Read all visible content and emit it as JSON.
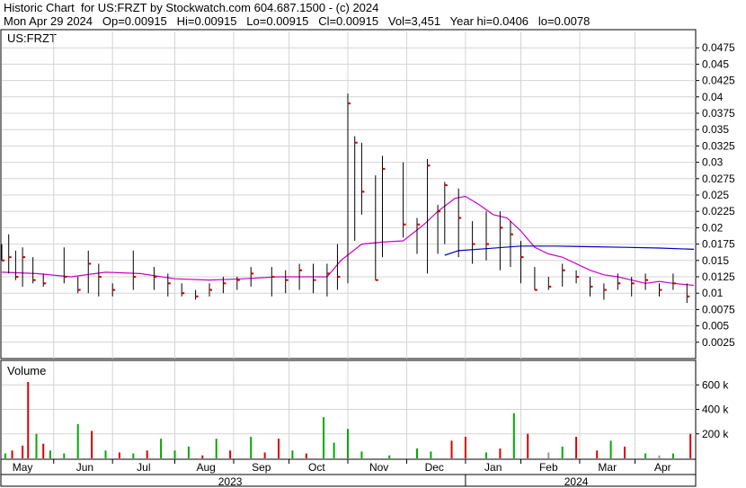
{
  "header": {
    "line1": "Historic Chart  for US:FRZT by Stockwatch.com 604.687.1500 - (c) 2024",
    "line2": "Mon Apr 29 2024   Op=0.00915   Hi=0.00915   Lo=0.00915   Cl=0.00915   Vol=3,451   Year hi=0.0406   lo=0.0078"
  },
  "chart_data": {
    "type": "ohlc-bar-with-volume",
    "symbol_label": "US:FRZT",
    "volume_label": "Volume",
    "price_axis": {
      "ylim": [
        0,
        0.05
      ],
      "ticks": [
        "0.0475",
        "0.045",
        "0.0425",
        "0.04",
        "0.0375",
        "0.035",
        "0.0325",
        "0.03",
        "0.0275",
        "0.025",
        "0.0225",
        "0.02",
        "0.0175",
        "0.015",
        "0.0125",
        "0.01",
        "0.0075",
        "0.005",
        "0.0025"
      ],
      "tick_values": [
        0.0475,
        0.045,
        0.0425,
        0.04,
        0.0375,
        0.035,
        0.0325,
        0.03,
        0.0275,
        0.025,
        0.0225,
        0.02,
        0.0175,
        0.015,
        0.0125,
        0.01,
        0.0075,
        0.005,
        0.0025
      ]
    },
    "volume_axis": {
      "ylim": [
        0,
        800000
      ],
      "ticks": [
        "600 k",
        "400 k",
        "200 k"
      ],
      "tick_values": [
        600000,
        400000,
        200000
      ]
    },
    "x_axis": {
      "months": [
        "May",
        "Jun",
        "Jul",
        "Aug",
        "Sep",
        "Oct",
        "Nov",
        "Dec",
        "Jan",
        "Feb",
        "Mar",
        "Apr"
      ],
      "years": [
        "2023",
        "2024"
      ]
    },
    "colors": {
      "price_bar": "#000000",
      "close_tick": "#cc0000",
      "ma_short": "#cc00cc",
      "ma_long": "#0000cc",
      "vol_up": "#00aa00",
      "vol_down": "#dd0000",
      "vol_neutral": "#999999",
      "grid": "#d4d4d4"
    },
    "series": [
      {
        "kind": "moving-average",
        "color": "#cc00cc",
        "points": [
          [
            0,
            0.0132
          ],
          [
            0.05,
            0.013
          ],
          [
            0.1,
            0.0125
          ],
          [
            0.15,
            0.0132
          ],
          [
            0.2,
            0.013
          ],
          [
            0.25,
            0.0122
          ],
          [
            0.3,
            0.012
          ],
          [
            0.35,
            0.0122
          ],
          [
            0.4,
            0.0125
          ],
          [
            0.45,
            0.0125
          ],
          [
            0.47,
            0.0125
          ],
          [
            0.49,
            0.015
          ],
          [
            0.52,
            0.0175
          ],
          [
            0.55,
            0.0178
          ],
          [
            0.58,
            0.018
          ],
          [
            0.61,
            0.0205
          ],
          [
            0.63,
            0.0225
          ],
          [
            0.655,
            0.0245
          ],
          [
            0.67,
            0.0248
          ],
          [
            0.69,
            0.0235
          ],
          [
            0.71,
            0.022
          ],
          [
            0.73,
            0.0215
          ],
          [
            0.75,
            0.0195
          ],
          [
            0.77,
            0.017
          ],
          [
            0.79,
            0.016
          ],
          [
            0.81,
            0.0155
          ],
          [
            0.83,
            0.0145
          ],
          [
            0.85,
            0.0135
          ],
          [
            0.87,
            0.0128
          ],
          [
            0.89,
            0.0125
          ],
          [
            0.91,
            0.012
          ],
          [
            0.93,
            0.0115
          ],
          [
            0.95,
            0.0118
          ],
          [
            0.97,
            0.0115
          ],
          [
            1.0,
            0.0112
          ]
        ]
      },
      {
        "kind": "moving-average",
        "color": "#0000cc",
        "points": [
          [
            0.64,
            0.0158
          ],
          [
            0.66,
            0.0165
          ],
          [
            0.7,
            0.0168
          ],
          [
            0.75,
            0.0172
          ],
          [
            0.8,
            0.0172
          ],
          [
            0.85,
            0.0171
          ],
          [
            0.9,
            0.017
          ],
          [
            0.95,
            0.0169
          ],
          [
            1.0,
            0.0167
          ]
        ]
      }
    ],
    "ohlc": [
      [
        0.0,
        0.0175,
        0.015,
        0.015
      ],
      [
        0.01,
        0.019,
        0.013,
        0.0155
      ],
      [
        0.02,
        0.0165,
        0.012,
        0.0125
      ],
      [
        0.03,
        0.017,
        0.011,
        0.0155
      ],
      [
        0.045,
        0.0155,
        0.0115,
        0.012
      ],
      [
        0.06,
        0.013,
        0.011,
        0.0115
      ],
      [
        0.09,
        0.017,
        0.0115,
        0.0125
      ],
      [
        0.11,
        0.0125,
        0.01,
        0.0105
      ],
      [
        0.125,
        0.0165,
        0.01,
        0.0145
      ],
      [
        0.14,
        0.0145,
        0.0095,
        0.0125
      ],
      [
        0.16,
        0.0115,
        0.0095,
        0.0105
      ],
      [
        0.19,
        0.0165,
        0.0105,
        0.0125
      ],
      [
        0.22,
        0.014,
        0.0105,
        0.0125
      ],
      [
        0.24,
        0.013,
        0.0095,
        0.0115
      ],
      [
        0.26,
        0.0115,
        0.0095,
        0.01
      ],
      [
        0.28,
        0.0105,
        0.009,
        0.0095
      ],
      [
        0.3,
        0.0115,
        0.0095,
        0.0105
      ],
      [
        0.32,
        0.0125,
        0.01,
        0.0115
      ],
      [
        0.34,
        0.0125,
        0.0105,
        0.012
      ],
      [
        0.36,
        0.014,
        0.011,
        0.013
      ],
      [
        0.39,
        0.014,
        0.0095,
        0.0125
      ],
      [
        0.41,
        0.0135,
        0.01,
        0.012
      ],
      [
        0.43,
        0.0145,
        0.0105,
        0.0135
      ],
      [
        0.45,
        0.0145,
        0.01,
        0.012
      ],
      [
        0.47,
        0.0145,
        0.0095,
        0.013
      ],
      [
        0.485,
        0.0175,
        0.0105,
        0.0125
      ],
      [
        0.5,
        0.0405,
        0.0115,
        0.039
      ],
      [
        0.51,
        0.034,
        0.018,
        0.033
      ],
      [
        0.52,
        0.033,
        0.022,
        0.0255
      ],
      [
        0.54,
        0.028,
        0.012,
        0.012
      ],
      [
        0.55,
        0.031,
        0.0155,
        0.029
      ],
      [
        0.58,
        0.03,
        0.0185,
        0.0205
      ],
      [
        0.6,
        0.0215,
        0.016,
        0.0205
      ],
      [
        0.615,
        0.0305,
        0.013,
        0.0295
      ],
      [
        0.63,
        0.0235,
        0.016,
        0.0225
      ],
      [
        0.64,
        0.027,
        0.0175,
        0.0265
      ],
      [
        0.66,
        0.026,
        0.0155,
        0.0215
      ],
      [
        0.68,
        0.021,
        0.0145,
        0.0175
      ],
      [
        0.7,
        0.0225,
        0.015,
        0.0175
      ],
      [
        0.72,
        0.0225,
        0.0135,
        0.02
      ],
      [
        0.735,
        0.021,
        0.014,
        0.019
      ],
      [
        0.75,
        0.018,
        0.0115,
        0.0155
      ],
      [
        0.77,
        0.014,
        0.0105,
        0.0105
      ],
      [
        0.79,
        0.0125,
        0.0105,
        0.011
      ],
      [
        0.81,
        0.0145,
        0.011,
        0.0135
      ],
      [
        0.83,
        0.0135,
        0.0115,
        0.0125
      ],
      [
        0.85,
        0.0125,
        0.0095,
        0.011
      ],
      [
        0.87,
        0.0115,
        0.009,
        0.0105
      ],
      [
        0.89,
        0.013,
        0.0105,
        0.0115
      ],
      [
        0.91,
        0.0125,
        0.0095,
        0.0115
      ],
      [
        0.93,
        0.013,
        0.0105,
        0.012
      ],
      [
        0.95,
        0.0115,
        0.0095,
        0.0105
      ],
      [
        0.97,
        0.013,
        0.0105,
        0.0115
      ],
      [
        0.99,
        0.0115,
        0.0085,
        0.0095
      ]
    ],
    "volume": [
      [
        0.005,
        0.05,
        "up"
      ],
      [
        0.015,
        0.08,
        "down"
      ],
      [
        0.03,
        0.13,
        "down"
      ],
      [
        0.038,
        0.78,
        "down"
      ],
      [
        0.05,
        0.25,
        "up"
      ],
      [
        0.06,
        0.15,
        "down"
      ],
      [
        0.07,
        0.08,
        "up"
      ],
      [
        0.09,
        0.05,
        "up"
      ],
      [
        0.11,
        0.35,
        "up"
      ],
      [
        0.13,
        0.28,
        "down"
      ],
      [
        0.15,
        0.08,
        "up"
      ],
      [
        0.17,
        0.06,
        "down"
      ],
      [
        0.19,
        0.05,
        "up"
      ],
      [
        0.21,
        0.08,
        "down"
      ],
      [
        0.23,
        0.2,
        "up"
      ],
      [
        0.25,
        0.08,
        "up"
      ],
      [
        0.27,
        0.12,
        "up"
      ],
      [
        0.29,
        0.03,
        "down"
      ],
      [
        0.31,
        0.2,
        "up"
      ],
      [
        0.33,
        0.08,
        "down"
      ],
      [
        0.36,
        0.22,
        "up"
      ],
      [
        0.38,
        0.06,
        "down"
      ],
      [
        0.4,
        0.2,
        "down"
      ],
      [
        0.42,
        0.08,
        "up"
      ],
      [
        0.44,
        0.05,
        "down"
      ],
      [
        0.465,
        0.42,
        "up"
      ],
      [
        0.48,
        0.16,
        "up"
      ],
      [
        0.5,
        0.3,
        "up"
      ],
      [
        0.52,
        0.07,
        "up"
      ],
      [
        0.56,
        0.03,
        "up"
      ],
      [
        0.6,
        0.1,
        "up"
      ],
      [
        0.62,
        0.07,
        "up"
      ],
      [
        0.65,
        0.18,
        "down"
      ],
      [
        0.67,
        0.22,
        "down"
      ],
      [
        0.7,
        0.06,
        "up"
      ],
      [
        0.72,
        0.1,
        "down"
      ],
      [
        0.74,
        0.46,
        "up"
      ],
      [
        0.76,
        0.25,
        "down"
      ],
      [
        0.79,
        0.06,
        "neutral"
      ],
      [
        0.81,
        0.12,
        "up"
      ],
      [
        0.83,
        0.22,
        "down"
      ],
      [
        0.86,
        0.08,
        "down"
      ],
      [
        0.88,
        0.18,
        "up"
      ],
      [
        0.9,
        0.12,
        "down"
      ],
      [
        0.93,
        0.05,
        "up"
      ],
      [
        0.95,
        0.03,
        "neutral"
      ],
      [
        0.97,
        0.05,
        "up"
      ],
      [
        0.995,
        0.25,
        "down"
      ]
    ]
  }
}
